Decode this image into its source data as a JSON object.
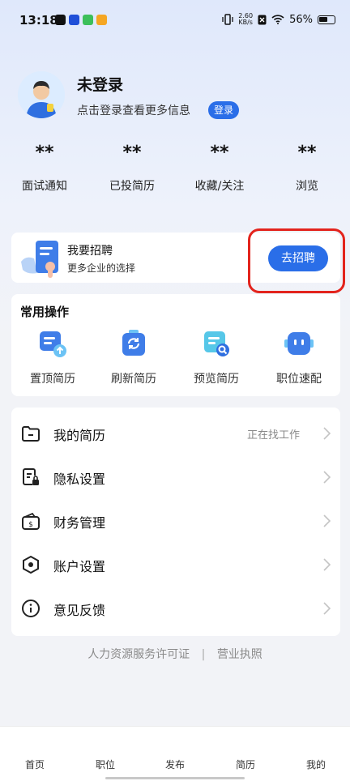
{
  "status_bar": {
    "time": "13:18",
    "net_speed_value": "2.60",
    "net_speed_unit": "KB/s",
    "battery": "56%"
  },
  "profile": {
    "name": "未登录",
    "subtitle": "点击登录查看更多信息",
    "login_label": "登录"
  },
  "stats": [
    {
      "value": "**",
      "label": "面试通知"
    },
    {
      "value": "**",
      "label": "已投简历"
    },
    {
      "value": "**",
      "label": "收藏/关注"
    },
    {
      "value": "**",
      "label": "浏览"
    }
  ],
  "recruit": {
    "title": "我要招聘",
    "subtitle": "更多企业的选择",
    "button": "去招聘"
  },
  "ops": {
    "title": "常用操作",
    "items": [
      {
        "label": "置顶简历",
        "icon": "pin-resume-icon"
      },
      {
        "label": "刷新简历",
        "icon": "refresh-resume-icon"
      },
      {
        "label": "预览简历",
        "icon": "preview-resume-icon"
      },
      {
        "label": "职位速配",
        "icon": "job-match-robot-icon"
      }
    ]
  },
  "menu": [
    {
      "label": "我的简历",
      "extra": "正在找工作",
      "icon": "resume-folder-icon"
    },
    {
      "label": "隐私设置",
      "extra": "",
      "icon": "privacy-lock-icon"
    },
    {
      "label": "财务管理",
      "extra": "",
      "icon": "wallet-icon"
    },
    {
      "label": "账户设置",
      "extra": "",
      "icon": "account-settings-icon"
    },
    {
      "label": "意见反馈",
      "extra": "",
      "icon": "feedback-info-icon"
    }
  ],
  "footer": {
    "license": "人力资源服务许可证",
    "separator": "|",
    "business": "营业执照"
  },
  "nav": [
    {
      "label": "首页"
    },
    {
      "label": "职位"
    },
    {
      "label": "发布"
    },
    {
      "label": "简历"
    },
    {
      "label": "我的"
    }
  ],
  "colors": {
    "accent": "#2a6ee8",
    "highlight": "#e3241d"
  }
}
